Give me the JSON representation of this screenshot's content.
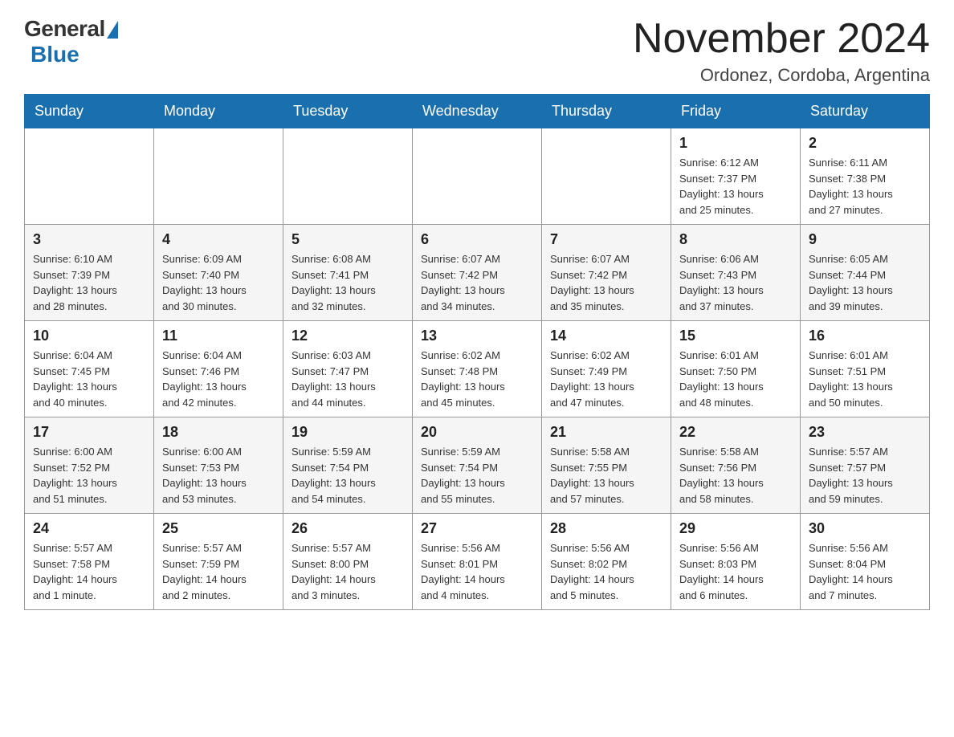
{
  "header": {
    "title": "November 2024",
    "subtitle": "Ordonez, Cordoba, Argentina"
  },
  "logo": {
    "general": "General",
    "blue": "Blue"
  },
  "days_of_week": [
    "Sunday",
    "Monday",
    "Tuesday",
    "Wednesday",
    "Thursday",
    "Friday",
    "Saturday"
  ],
  "weeks": [
    [
      {
        "day": "",
        "info": ""
      },
      {
        "day": "",
        "info": ""
      },
      {
        "day": "",
        "info": ""
      },
      {
        "day": "",
        "info": ""
      },
      {
        "day": "",
        "info": ""
      },
      {
        "day": "1",
        "info": "Sunrise: 6:12 AM\nSunset: 7:37 PM\nDaylight: 13 hours\nand 25 minutes."
      },
      {
        "day": "2",
        "info": "Sunrise: 6:11 AM\nSunset: 7:38 PM\nDaylight: 13 hours\nand 27 minutes."
      }
    ],
    [
      {
        "day": "3",
        "info": "Sunrise: 6:10 AM\nSunset: 7:39 PM\nDaylight: 13 hours\nand 28 minutes."
      },
      {
        "day": "4",
        "info": "Sunrise: 6:09 AM\nSunset: 7:40 PM\nDaylight: 13 hours\nand 30 minutes."
      },
      {
        "day": "5",
        "info": "Sunrise: 6:08 AM\nSunset: 7:41 PM\nDaylight: 13 hours\nand 32 minutes."
      },
      {
        "day": "6",
        "info": "Sunrise: 6:07 AM\nSunset: 7:42 PM\nDaylight: 13 hours\nand 34 minutes."
      },
      {
        "day": "7",
        "info": "Sunrise: 6:07 AM\nSunset: 7:42 PM\nDaylight: 13 hours\nand 35 minutes."
      },
      {
        "day": "8",
        "info": "Sunrise: 6:06 AM\nSunset: 7:43 PM\nDaylight: 13 hours\nand 37 minutes."
      },
      {
        "day": "9",
        "info": "Sunrise: 6:05 AM\nSunset: 7:44 PM\nDaylight: 13 hours\nand 39 minutes."
      }
    ],
    [
      {
        "day": "10",
        "info": "Sunrise: 6:04 AM\nSunset: 7:45 PM\nDaylight: 13 hours\nand 40 minutes."
      },
      {
        "day": "11",
        "info": "Sunrise: 6:04 AM\nSunset: 7:46 PM\nDaylight: 13 hours\nand 42 minutes."
      },
      {
        "day": "12",
        "info": "Sunrise: 6:03 AM\nSunset: 7:47 PM\nDaylight: 13 hours\nand 44 minutes."
      },
      {
        "day": "13",
        "info": "Sunrise: 6:02 AM\nSunset: 7:48 PM\nDaylight: 13 hours\nand 45 minutes."
      },
      {
        "day": "14",
        "info": "Sunrise: 6:02 AM\nSunset: 7:49 PM\nDaylight: 13 hours\nand 47 minutes."
      },
      {
        "day": "15",
        "info": "Sunrise: 6:01 AM\nSunset: 7:50 PM\nDaylight: 13 hours\nand 48 minutes."
      },
      {
        "day": "16",
        "info": "Sunrise: 6:01 AM\nSunset: 7:51 PM\nDaylight: 13 hours\nand 50 minutes."
      }
    ],
    [
      {
        "day": "17",
        "info": "Sunrise: 6:00 AM\nSunset: 7:52 PM\nDaylight: 13 hours\nand 51 minutes."
      },
      {
        "day": "18",
        "info": "Sunrise: 6:00 AM\nSunset: 7:53 PM\nDaylight: 13 hours\nand 53 minutes."
      },
      {
        "day": "19",
        "info": "Sunrise: 5:59 AM\nSunset: 7:54 PM\nDaylight: 13 hours\nand 54 minutes."
      },
      {
        "day": "20",
        "info": "Sunrise: 5:59 AM\nSunset: 7:54 PM\nDaylight: 13 hours\nand 55 minutes."
      },
      {
        "day": "21",
        "info": "Sunrise: 5:58 AM\nSunset: 7:55 PM\nDaylight: 13 hours\nand 57 minutes."
      },
      {
        "day": "22",
        "info": "Sunrise: 5:58 AM\nSunset: 7:56 PM\nDaylight: 13 hours\nand 58 minutes."
      },
      {
        "day": "23",
        "info": "Sunrise: 5:57 AM\nSunset: 7:57 PM\nDaylight: 13 hours\nand 59 minutes."
      }
    ],
    [
      {
        "day": "24",
        "info": "Sunrise: 5:57 AM\nSunset: 7:58 PM\nDaylight: 14 hours\nand 1 minute."
      },
      {
        "day": "25",
        "info": "Sunrise: 5:57 AM\nSunset: 7:59 PM\nDaylight: 14 hours\nand 2 minutes."
      },
      {
        "day": "26",
        "info": "Sunrise: 5:57 AM\nSunset: 8:00 PM\nDaylight: 14 hours\nand 3 minutes."
      },
      {
        "day": "27",
        "info": "Sunrise: 5:56 AM\nSunset: 8:01 PM\nDaylight: 14 hours\nand 4 minutes."
      },
      {
        "day": "28",
        "info": "Sunrise: 5:56 AM\nSunset: 8:02 PM\nDaylight: 14 hours\nand 5 minutes."
      },
      {
        "day": "29",
        "info": "Sunrise: 5:56 AM\nSunset: 8:03 PM\nDaylight: 14 hours\nand 6 minutes."
      },
      {
        "day": "30",
        "info": "Sunrise: 5:56 AM\nSunset: 8:04 PM\nDaylight: 14 hours\nand 7 minutes."
      }
    ]
  ]
}
